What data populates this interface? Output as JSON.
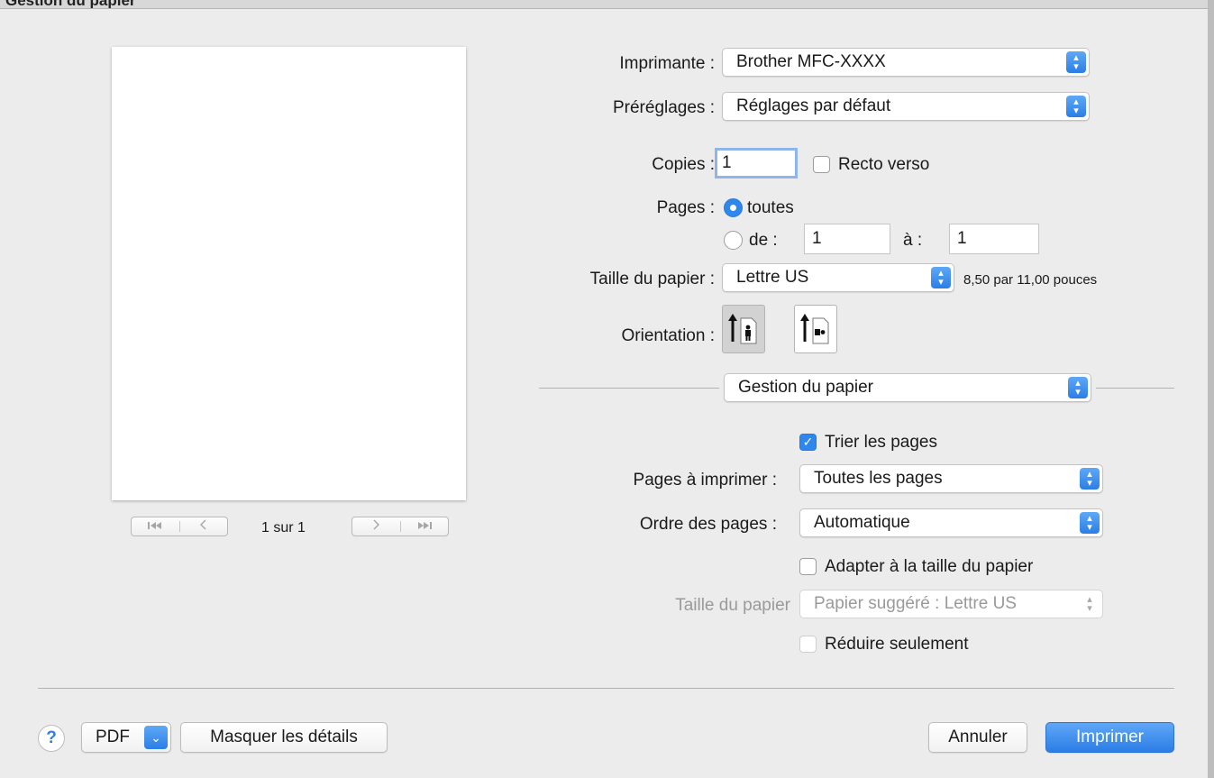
{
  "window": {
    "title": "Gestion du papier"
  },
  "preview": {
    "page_indicator": "1 sur 1"
  },
  "printer": {
    "label": "Imprimante :",
    "value": "Brother MFC-XXXX"
  },
  "presets": {
    "label": "Préréglages :",
    "value": "Réglages par défaut"
  },
  "copies": {
    "label": "Copies :",
    "value": "1",
    "duplex_label": "Recto verso",
    "duplex_checked": false
  },
  "pages": {
    "label": "Pages :",
    "all_label": "toutes",
    "from_label": "de :",
    "from_value": "1",
    "to_label": "à :",
    "to_value": "1",
    "selected": "toutes"
  },
  "paper_size": {
    "label": "Taille du papier :",
    "value": "Lettre US",
    "dimensions": "8,50 par 11,00 pouces"
  },
  "orientation": {
    "label": "Orientation :",
    "selected": "portrait"
  },
  "section": {
    "value": "Gestion du papier"
  },
  "paper_handling": {
    "collate_label": "Trier les pages",
    "collate_checked": true,
    "pages_to_print_label": "Pages à imprimer :",
    "pages_to_print_value": "Toutes les pages",
    "page_order_label": "Ordre des pages :",
    "page_order_value": "Automatique",
    "scale_label": "Adapter à la taille du papier",
    "scale_checked": false,
    "dest_paper_label": "Taille du papier",
    "dest_paper_value": "Papier suggéré : Lettre US",
    "scale_down_label": "Réduire seulement",
    "scale_down_checked": false
  },
  "footer": {
    "help_glyph": "?",
    "pdf_label": "PDF",
    "hide_details_label": "Masquer les détails",
    "cancel_label": "Annuler",
    "print_label": "Imprimer"
  },
  "colors": {
    "accent": "#2f87ee",
    "background": "#ececec"
  }
}
